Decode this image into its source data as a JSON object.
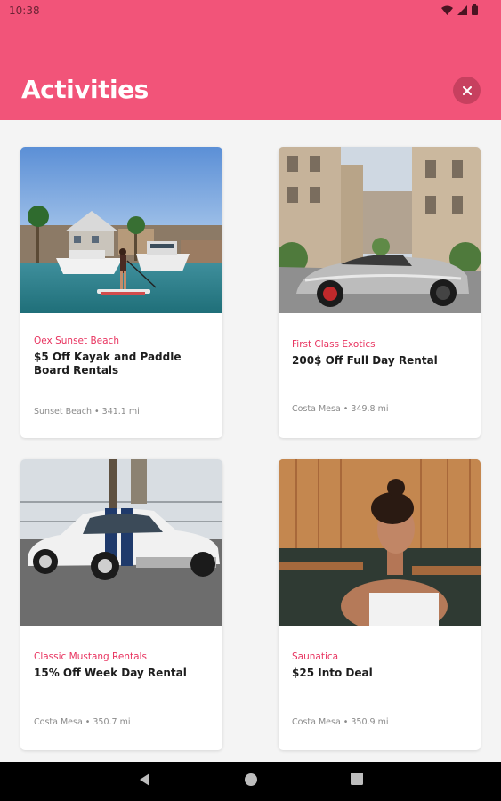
{
  "status_bar": {
    "time": "10:38",
    "icons": [
      "wifi-icon",
      "signal-icon",
      "battery-icon"
    ]
  },
  "header": {
    "title": "Activities",
    "close_icon": "close-icon",
    "background": "#f25479"
  },
  "cards": [
    {
      "vendor": "Oex Sunset Beach",
      "offer": "$5 Off Kayak and Paddle Board Rentals",
      "location": "Sunset Beach",
      "distance": "341.1 mi",
      "image": "paddleboard-on-harbor"
    },
    {
      "vendor": "First Class Exotics",
      "offer": "200$ Off Full Day Rental",
      "location": "Costa Mesa",
      "distance": "349.8 mi",
      "image": "chrome-sports-car"
    },
    {
      "vendor": "Classic Mustang Rentals",
      "offer": "15% Off Week Day Rental",
      "location": "Costa Mesa",
      "distance": "350.7 mi",
      "image": "white-classic-mustang"
    },
    {
      "vendor": "Saunatica",
      "offer": "$25 Into Deal",
      "location": "Costa Mesa",
      "distance": "350.9 mi",
      "image": "woman-in-sauna"
    }
  ],
  "nav": {
    "back": "back-icon",
    "home": "home-icon",
    "recents": "recents-icon"
  },
  "colors": {
    "accent": "#f25479",
    "vendor_text": "#e8335f"
  }
}
